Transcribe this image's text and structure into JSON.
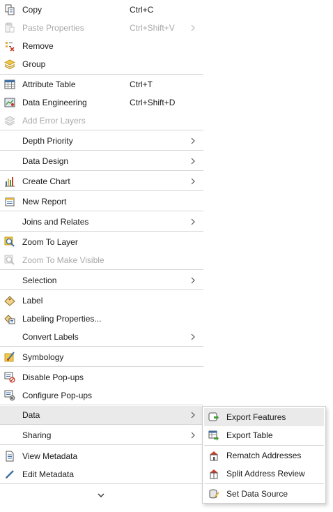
{
  "menu": {
    "items": [
      {
        "label": "Copy",
        "shortcut": "Ctrl+C",
        "icon": "copy-icon"
      },
      {
        "label": "Paste Properties",
        "shortcut": "Ctrl+Shift+V",
        "icon": "paste-properties-icon",
        "disabled": true,
        "submenu": true
      },
      {
        "label": "Remove",
        "icon": "remove-icon"
      },
      {
        "label": "Group",
        "icon": "group-icon"
      },
      {
        "label": "Attribute Table",
        "shortcut": "Ctrl+T",
        "icon": "attribute-table-icon"
      },
      {
        "label": "Data Engineering",
        "shortcut": "Ctrl+Shift+D",
        "icon": "data-engineering-icon"
      },
      {
        "label": "Add Error Layers",
        "icon": "add-error-layers-icon",
        "disabled": true
      },
      {
        "label": "Depth Priority",
        "submenu": true
      },
      {
        "label": "Data Design",
        "submenu": true
      },
      {
        "label": "Create Chart",
        "icon": "chart-icon",
        "submenu": true
      },
      {
        "label": "New Report",
        "icon": "report-icon"
      },
      {
        "label": "Joins and Relates",
        "submenu": true
      },
      {
        "label": "Zoom To Layer",
        "icon": "zoom-to-layer-icon"
      },
      {
        "label": "Zoom To Make Visible",
        "icon": "zoom-to-make-visible-icon",
        "disabled": true
      },
      {
        "label": "Selection",
        "submenu": true
      },
      {
        "label": "Label",
        "icon": "label-icon"
      },
      {
        "label": "Labeling Properties...",
        "icon": "labeling-properties-icon"
      },
      {
        "label": "Convert Labels",
        "submenu": true
      },
      {
        "label": "Symbology",
        "icon": "symbology-icon"
      },
      {
        "label": "Disable Pop-ups",
        "icon": "disable-popups-icon"
      },
      {
        "label": "Configure Pop-ups",
        "icon": "configure-popups-icon"
      },
      {
        "label": "Data",
        "submenu": true,
        "highlighted": true
      },
      {
        "label": "Sharing",
        "submenu": true
      },
      {
        "label": "View Metadata",
        "icon": "view-metadata-icon"
      },
      {
        "label": "Edit Metadata",
        "icon": "edit-metadata-icon"
      }
    ]
  },
  "submenu": {
    "items": [
      {
        "label": "Export Features",
        "icon": "export-features-icon",
        "highlighted": true
      },
      {
        "label": "Export Table",
        "icon": "export-table-icon"
      },
      {
        "label": "Rematch Addresses",
        "icon": "rematch-addresses-icon"
      },
      {
        "label": "Split Address Review",
        "icon": "split-address-review-icon"
      },
      {
        "label": "Set Data Source",
        "icon": "set-data-source-icon"
      }
    ]
  },
  "colors": {
    "highlight": "#eaeaea",
    "disabled_text": "#a8a8a8",
    "separator": "#d6d6d6",
    "icon_blue": "#3c6ea5",
    "icon_gold": "#e3b23c",
    "icon_green": "#4a9a3c",
    "icon_red": "#c8402c"
  }
}
